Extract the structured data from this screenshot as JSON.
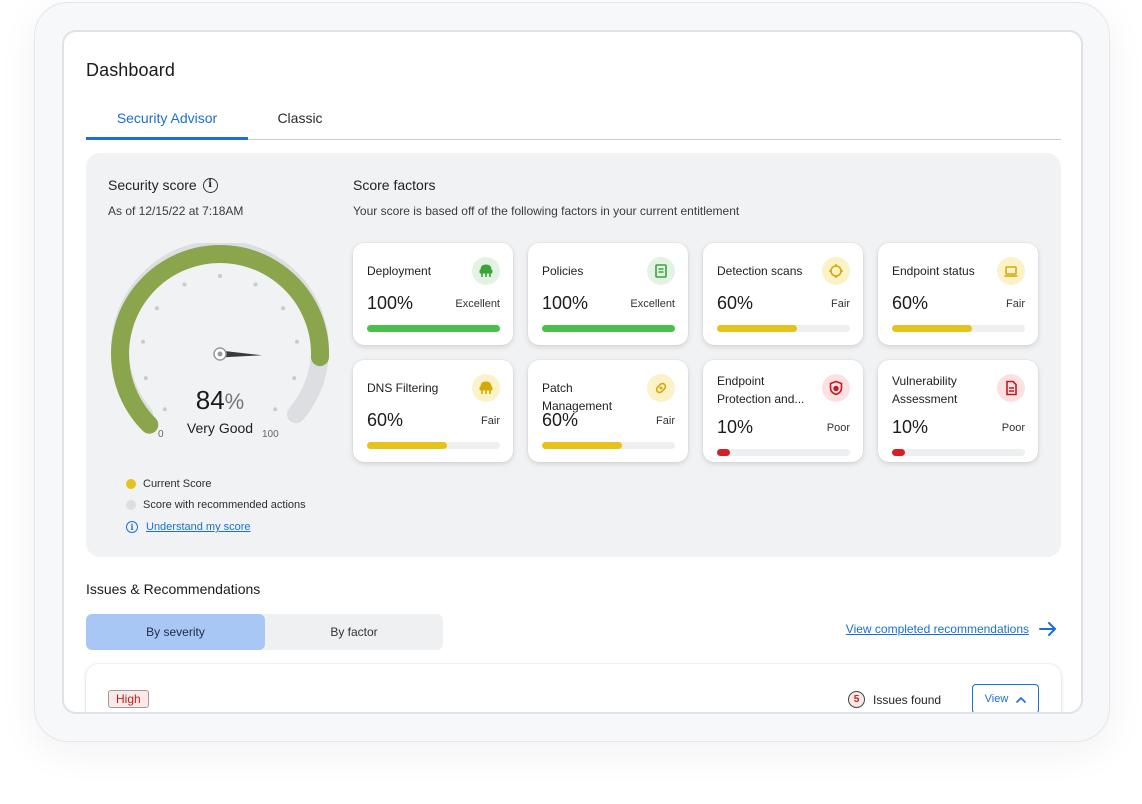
{
  "page": {
    "title": "Dashboard"
  },
  "tabs": [
    {
      "label": "Security Advisor",
      "active": true
    },
    {
      "label": "Classic",
      "active": false
    }
  ],
  "security_score": {
    "title": "Security score",
    "as_of": "As of 12/15/22 at 7:18AM",
    "value": "84",
    "value_fraction": 0.84,
    "unit": "%",
    "rating": "Very Good",
    "gauge_min": "0",
    "gauge_max": "100",
    "gauge_color": "#8aa54c",
    "legend": [
      {
        "label": "Current Score",
        "color": "#e6c21c"
      },
      {
        "label": "Score with recommended actions",
        "color": "#dcdee1"
      }
    ],
    "link": "Understand my score"
  },
  "score_factors": {
    "title": "Score factors",
    "subtitle": "Your score is based off of the following factors in your current entitlement",
    "cards": [
      {
        "name": "Deployment",
        "percent": "100%",
        "fraction": 1.0,
        "rating": "Excellent",
        "icon": "deployment-icon",
        "color": "#4bbf4b",
        "icon_bg": "#e3f3e3",
        "icon_color": "#3aa33a"
      },
      {
        "name": "Policies",
        "percent": "100%",
        "fraction": 1.0,
        "rating": "Excellent",
        "icon": "policy-document-icon",
        "color": "#4bbf4b",
        "icon_bg": "#e3f3e3",
        "icon_color": "#3aa33a"
      },
      {
        "name": "Detection scans",
        "percent": "60%",
        "fraction": 0.6,
        "rating": "Fair",
        "icon": "crosshair-icon",
        "color": "#e6c21c",
        "icon_bg": "#fbf2c8",
        "icon_color": "#d4a90a"
      },
      {
        "name": "Endpoint status",
        "percent": "60%",
        "fraction": 0.6,
        "rating": "Fair",
        "icon": "laptop-icon",
        "color": "#e6c21c",
        "icon_bg": "#fbf2c8",
        "icon_color": "#d4a90a"
      },
      {
        "name": "DNS Filtering",
        "percent": "60%",
        "fraction": 0.6,
        "rating": "Fair",
        "icon": "dns-filter-icon",
        "color": "#e6c21c",
        "icon_bg": "#fbf2c8",
        "icon_color": "#d4a90a"
      },
      {
        "name": "Patch Management",
        "percent": "60%",
        "fraction": 0.6,
        "rating": "Fair",
        "icon": "patch-icon",
        "color": "#e6c21c",
        "icon_bg": "#fbf2c8",
        "icon_color": "#d4a90a"
      },
      {
        "name": "Endpoint Protection and...",
        "percent": "10%",
        "fraction": 0.1,
        "rating": "Poor",
        "icon": "shield-bug-icon",
        "color": "#d61f26",
        "icon_bg": "#fbe1e2",
        "icon_color": "#c8161d"
      },
      {
        "name": "Vulnerability Assessment",
        "percent": "10%",
        "fraction": 0.1,
        "rating": "Poor",
        "icon": "report-document-icon",
        "color": "#d61f26",
        "icon_bg": "#fbe1e2",
        "icon_color": "#c8161d"
      }
    ]
  },
  "issues": {
    "title": "Issues & Recommendations",
    "segments": [
      {
        "label": "By severity",
        "active": true
      },
      {
        "label": "By factor",
        "active": false
      }
    ],
    "view_completed": "View completed recommendations",
    "group": {
      "severity": "High",
      "count": "5",
      "count_label": "Issues found",
      "view_label": "View"
    }
  }
}
